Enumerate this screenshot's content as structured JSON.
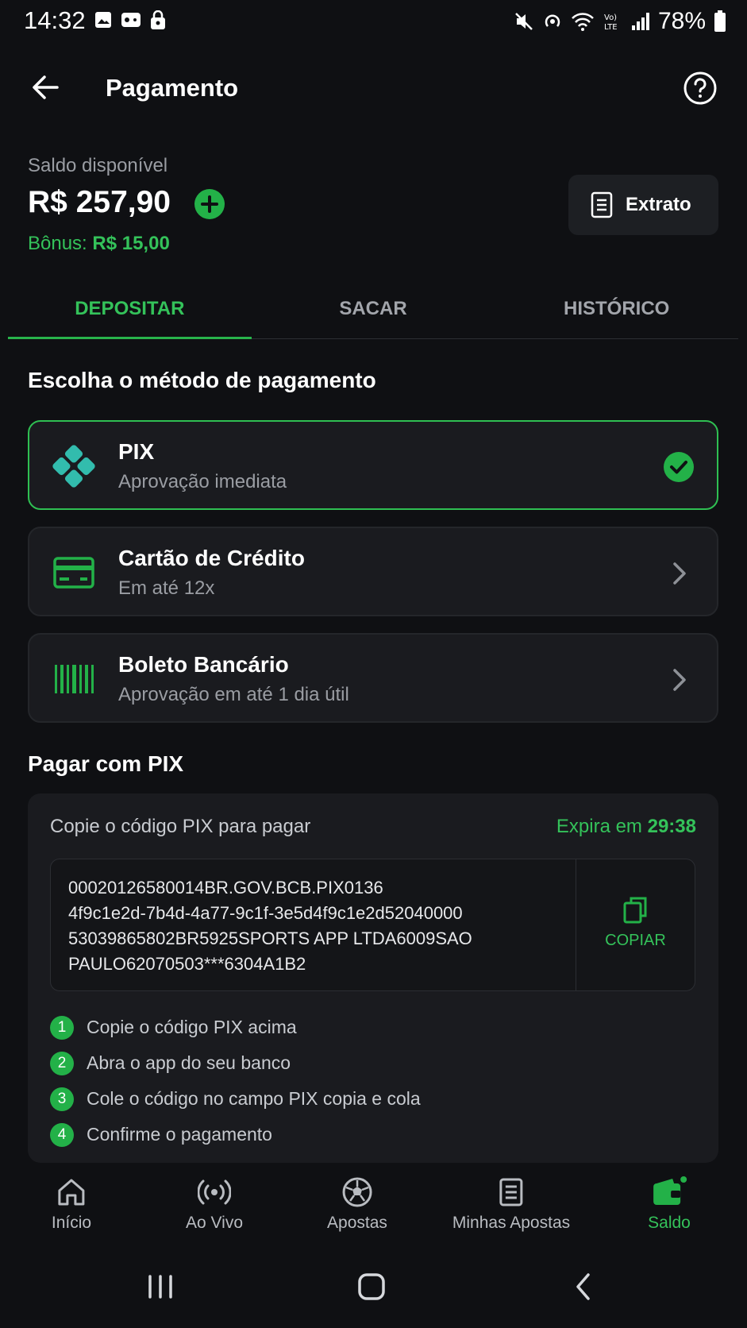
{
  "status_bar": {
    "time": "14:32",
    "battery": "78%",
    "icons": [
      "gallery-icon",
      "game-icon",
      "lock-bag-icon",
      "mute-icon",
      "hotspot-icon",
      "wifi-icon",
      "volte-icon",
      "signal-icon",
      "battery-icon"
    ]
  },
  "header": {
    "title": "Pagamento",
    "back_icon": "arrow-left-icon",
    "help_icon": "help-circle-icon"
  },
  "balance": {
    "label": "Saldo disponível",
    "value": "R$ 257,90",
    "bonus_label": "Bônus:",
    "bonus_value": "R$ 15,00",
    "extrato_label": "Extrato"
  },
  "tabs": [
    {
      "label": "DEPOSITAR",
      "active": true
    },
    {
      "label": "SACAR",
      "active": false
    },
    {
      "label": "HISTÓRICO",
      "active": false
    }
  ],
  "methods_title": "Escolha o método de pagamento",
  "methods": [
    {
      "name": "PIX",
      "desc": "Aprovação imediata",
      "icon": "pix-icon",
      "selected": true
    },
    {
      "name": "Cartão de Crédito",
      "desc": "Em até 12x",
      "icon": "credit-card-icon",
      "selected": false
    },
    {
      "name": "Boleto Bancário",
      "desc": "Aprovação em até 1 dia útil",
      "icon": "barcode-icon",
      "selected": false
    }
  ],
  "pix": {
    "section_title": "Pagar com PIX",
    "copy_label": "Copie o código PIX para pagar",
    "expire_label": "Expira em",
    "expire_time": "29:38",
    "code": "00020126580014BR.GOV.BCB.PIX0136\n4f9c1e2d-7b4d-4a77-9c1f-3e5d4f9c1e2d52040000\n53039865802BR5925SPORTS APP LTDA6009SAO\nPAULO62070503***6304A1B2",
    "copy_button": "COPIAR",
    "steps": [
      {
        "num": "1",
        "text": "Copie o código PIX acima"
      },
      {
        "num": "2",
        "text": "Abra o app do seu banco"
      },
      {
        "num": "3",
        "text": "Cole o código no campo PIX copia e cola"
      },
      {
        "num": "4",
        "text": "Confirme o pagamento"
      }
    ]
  },
  "bottom_nav": [
    {
      "label": "Início",
      "icon": "home-icon",
      "active": false
    },
    {
      "label": "Ao Vivo",
      "icon": "live-icon",
      "active": false
    },
    {
      "label": "Apostas",
      "icon": "soccer-ball-icon",
      "active": false
    },
    {
      "label": "Minhas Apostas",
      "icon": "receipt-icon",
      "active": false
    },
    {
      "label": "Saldo",
      "icon": "wallet-icon",
      "active": true
    }
  ],
  "colors": {
    "background": "#0f1013",
    "card": "#1a1b1f",
    "accent": "#34c25a",
    "pix_teal": "#32bcad"
  }
}
